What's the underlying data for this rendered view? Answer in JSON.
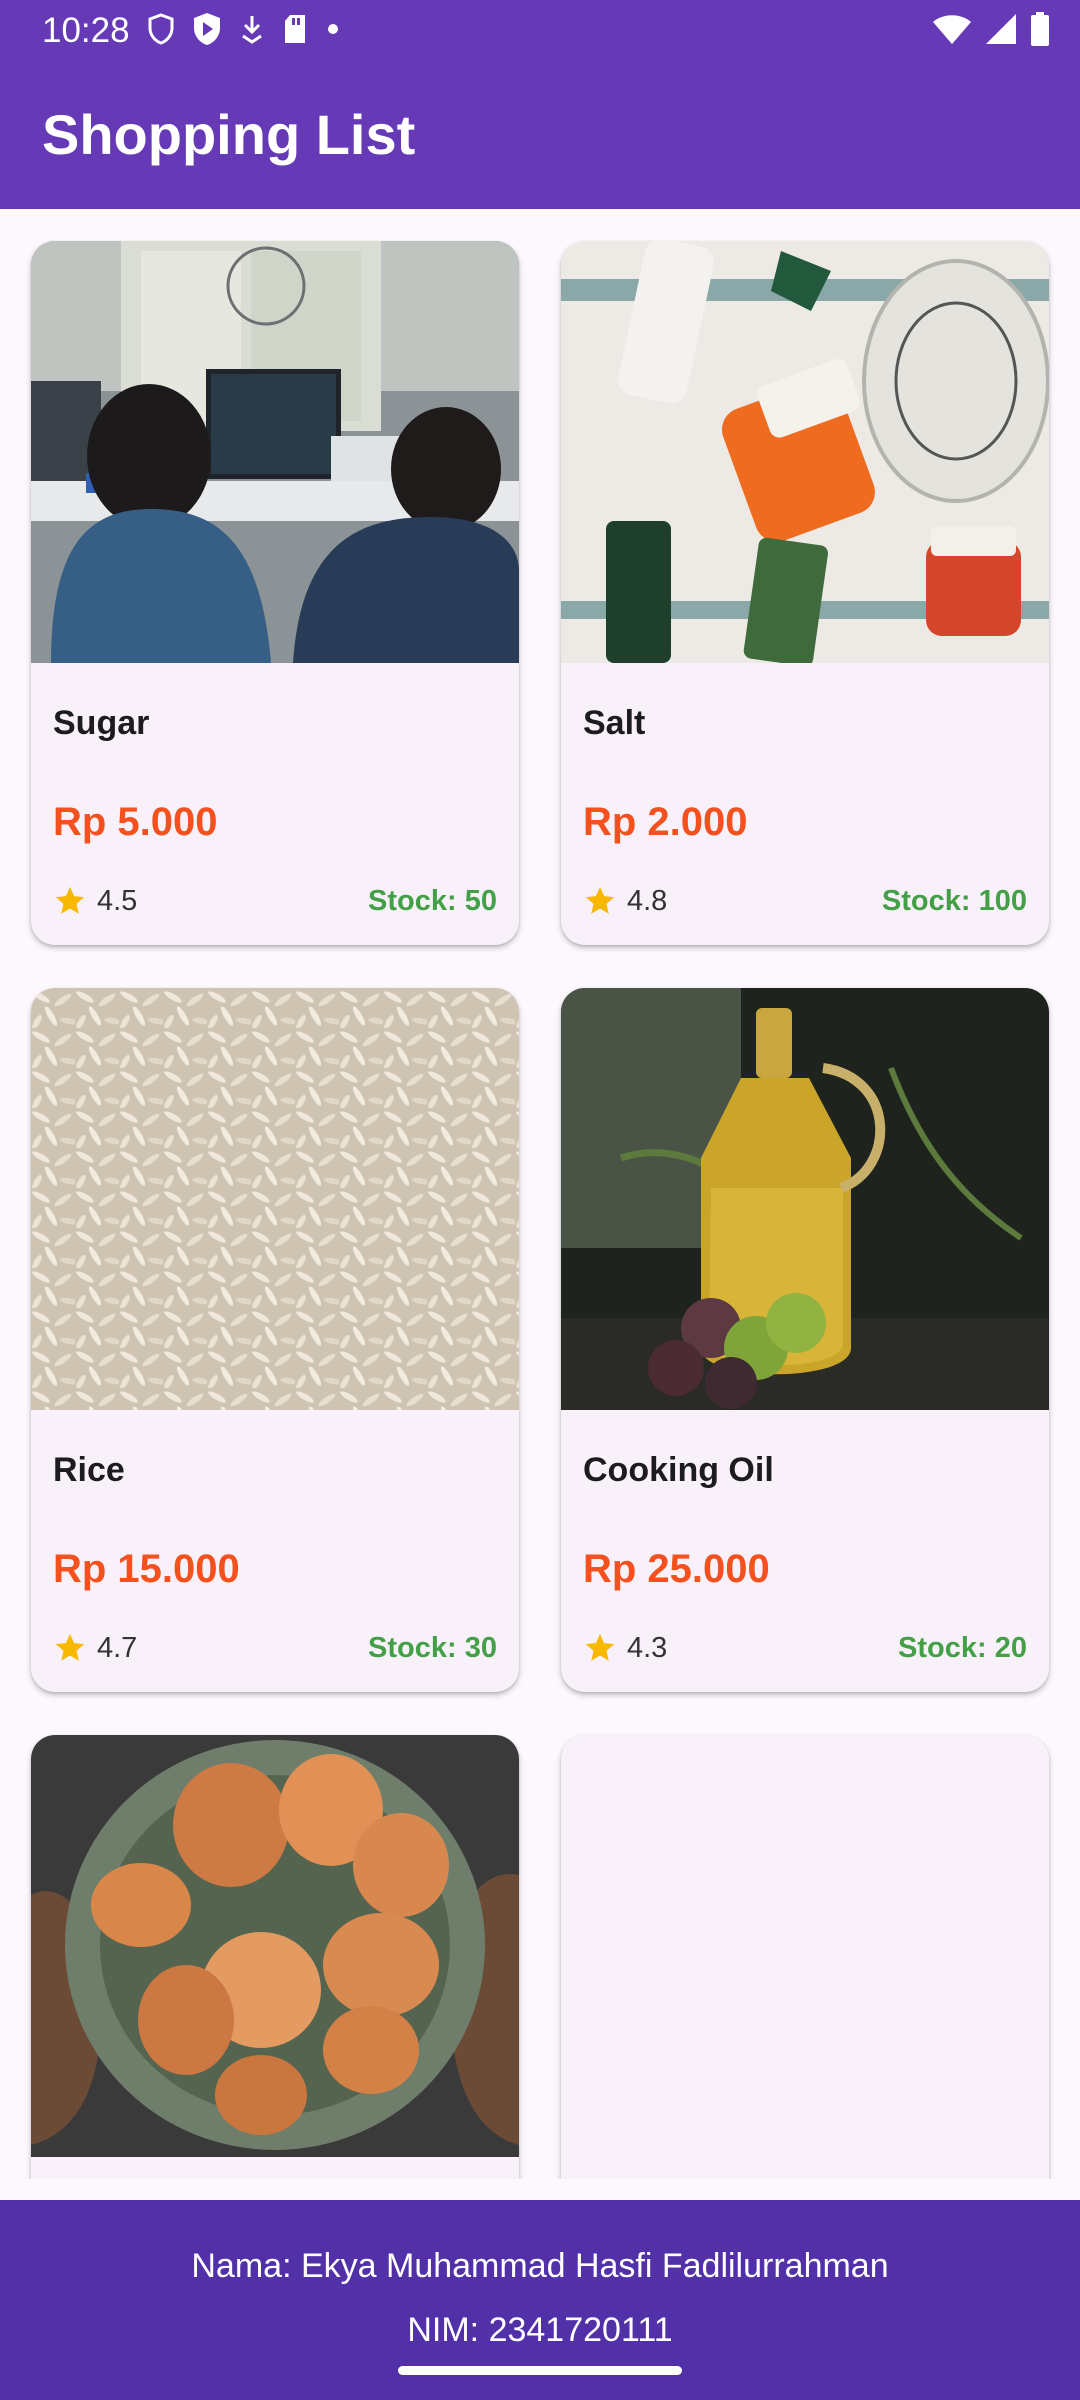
{
  "status_bar": {
    "time": "10:28",
    "left_icons": [
      "shield-outline-icon",
      "play-protect-icon",
      "download-icon",
      "sd-card-icon",
      "dot-icon"
    ],
    "right_icons": [
      "wifi-icon",
      "cell-signal-icon",
      "battery-icon"
    ]
  },
  "app_bar": {
    "title": "Shopping List",
    "color": "#6639b6"
  },
  "products": [
    {
      "name": "Sugar",
      "price": "Rp 5.000",
      "rating": "4.5",
      "stock": "Stock: 50",
      "image": "photo-two-people-at-computer"
    },
    {
      "name": "Salt",
      "price": "Rp 2.000",
      "rating": "4.8",
      "stock": "Stock: 100",
      "image": "photo-skincare-products"
    },
    {
      "name": "Rice",
      "price": "Rp 15.000",
      "rating": "4.7",
      "stock": "Stock: 30",
      "image": "photo-rice-grains"
    },
    {
      "name": "Cooking Oil",
      "price": "Rp 25.000",
      "rating": "4.3",
      "stock": "Stock: 20",
      "image": "photo-oil-bottle-olives"
    },
    {
      "name": "",
      "price": "",
      "rating": "",
      "stock": "",
      "image": "photo-bowl-of-eggs"
    },
    {
      "name": "",
      "price": "",
      "rating": "",
      "stock": "",
      "image": "blank"
    }
  ],
  "colors": {
    "price": "#f4511e",
    "stock": "#43a047",
    "star": "#f9b800",
    "card_bg": "#f8f1fa",
    "footer_bg": "#5230a8"
  },
  "footer": {
    "name": "Nama: Ekya Muhammad Hasfi Fadlilurrahman",
    "nim": "NIM: 2341720111"
  }
}
